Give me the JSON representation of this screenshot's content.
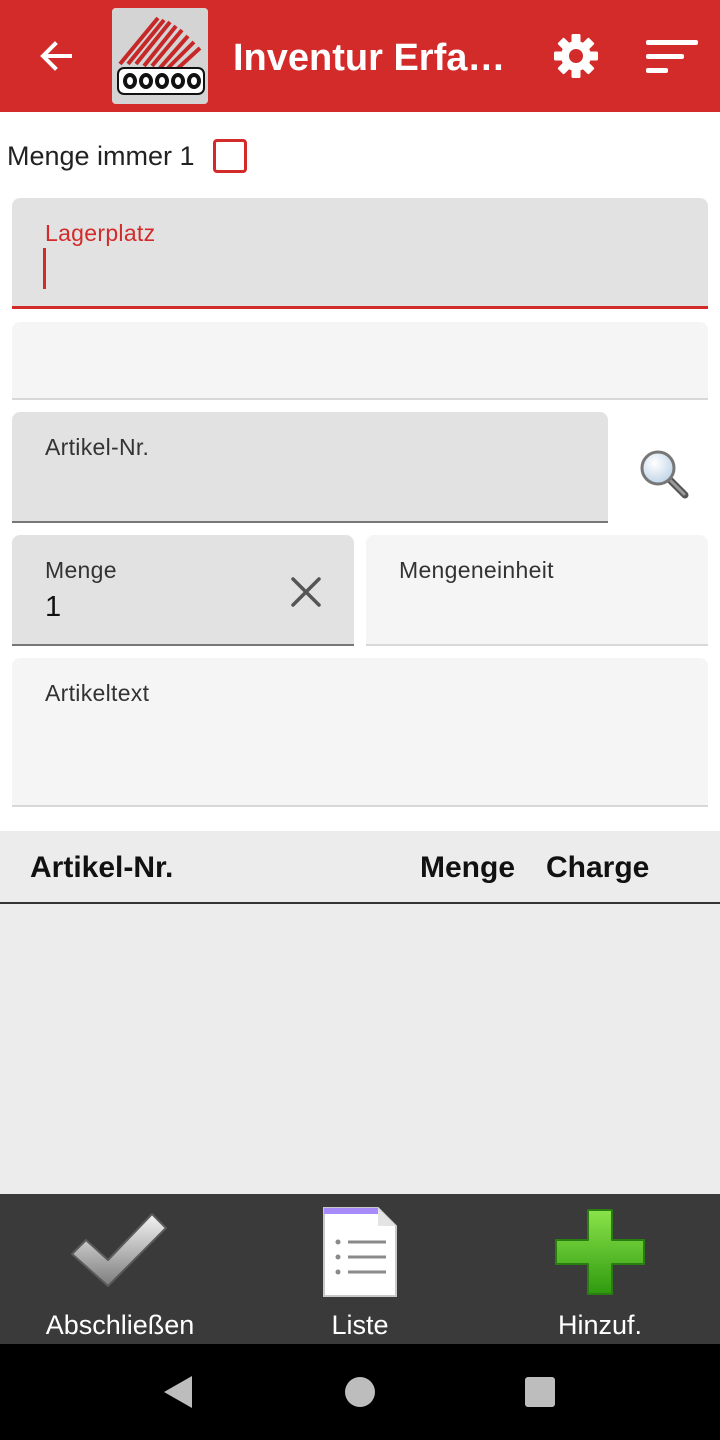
{
  "app": {
    "title": "Inventur Erfas…",
    "colors": {
      "primary": "#d32a2a",
      "bottom_bar": "#3a3a3a",
      "field_active_bg": "#e2e2e2",
      "field_inactive_bg": "#f5f5f5",
      "add_green": "#4caf1a"
    },
    "icons": {
      "back": "arrow-left-icon",
      "logo": "cosys-logo",
      "settings": "gear-icon",
      "sort": "sort-icon",
      "search": "magnifier-icon",
      "clear": "close-icon"
    }
  },
  "options": {
    "always_one_label": "Menge immer 1",
    "always_one_checked": false
  },
  "form": {
    "lagerplatz": {
      "label": "Lagerplatz",
      "value": ""
    },
    "blank": {
      "value": ""
    },
    "artikelnr": {
      "label": "Artikel-Nr.",
      "value": ""
    },
    "menge": {
      "label": "Menge",
      "value": "1"
    },
    "mengeneinheit": {
      "label": "Mengeneinheit",
      "value": ""
    },
    "artikeltext": {
      "label": "Artikeltext",
      "value": ""
    }
  },
  "table": {
    "columns": [
      "Artikel-Nr.",
      "Menge",
      "Charge"
    ],
    "rows": []
  },
  "bottom_bar": {
    "finish": {
      "label": "Abschließen",
      "icon": "checkmark-icon"
    },
    "list": {
      "label": "Liste",
      "icon": "document-list-icon"
    },
    "add": {
      "label": "Hinzuf.",
      "icon": "plus-icon"
    }
  },
  "system_nav": {
    "back": "nav-back-icon",
    "home": "nav-home-icon",
    "recents": "nav-recents-icon"
  }
}
